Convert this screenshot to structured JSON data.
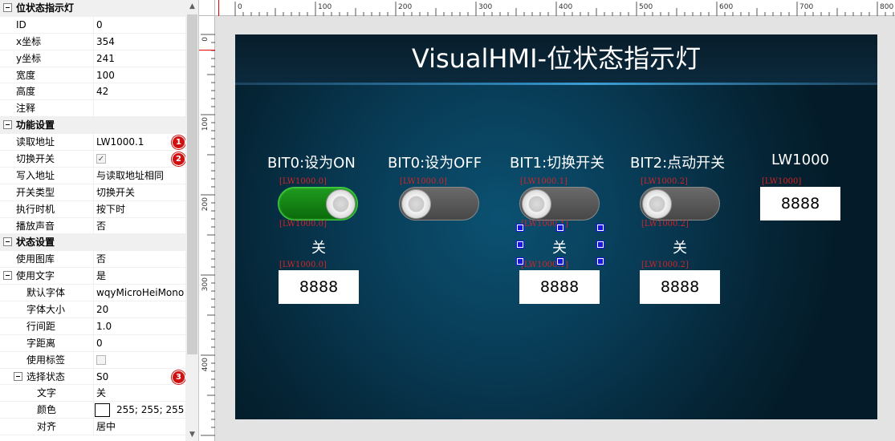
{
  "property_grid": {
    "rows": [
      {
        "kind": "category",
        "label": "位状态指示灯"
      },
      {
        "kind": "prop",
        "label": "ID",
        "value": "0"
      },
      {
        "kind": "prop",
        "label": "x坐标",
        "value": "354"
      },
      {
        "kind": "prop",
        "label": "y坐标",
        "value": "241"
      },
      {
        "kind": "prop",
        "label": "宽度",
        "value": "100"
      },
      {
        "kind": "prop",
        "label": "高度",
        "value": "42"
      },
      {
        "kind": "prop",
        "label": "注释",
        "value": ""
      },
      {
        "kind": "category",
        "label": "功能设置"
      },
      {
        "kind": "prop",
        "label": "读取地址",
        "value": "LW1000.1",
        "badge": "1"
      },
      {
        "kind": "check",
        "label": "切换开关",
        "checked": true,
        "badge": "2"
      },
      {
        "kind": "prop",
        "label": "写入地址",
        "value": "与读取地址相同"
      },
      {
        "kind": "prop",
        "label": "开关类型",
        "value": "切换开关"
      },
      {
        "kind": "prop",
        "label": "执行时机",
        "value": "按下时"
      },
      {
        "kind": "prop",
        "label": "播放声音",
        "value": "否"
      },
      {
        "kind": "category",
        "label": "状态设置"
      },
      {
        "kind": "prop",
        "label": "使用图库",
        "value": "否"
      },
      {
        "kind": "subcategory",
        "label": "使用文字",
        "value": "是"
      },
      {
        "kind": "prop",
        "indent": 2,
        "label": "默认字体",
        "value": "wqyMicroHeiMono"
      },
      {
        "kind": "prop",
        "indent": 2,
        "label": "字体大小",
        "value": "20"
      },
      {
        "kind": "prop",
        "indent": 2,
        "label": "行间距",
        "value": "1.0"
      },
      {
        "kind": "prop",
        "indent": 2,
        "label": "字距离",
        "value": "0"
      },
      {
        "kind": "check",
        "indent": 2,
        "label": "使用标签",
        "checked": false
      },
      {
        "kind": "subcategory",
        "indent": 2,
        "label": "选择状态",
        "value": "S0",
        "badge": "3"
      },
      {
        "kind": "prop",
        "indent": 3,
        "label": "文字",
        "value": "关"
      },
      {
        "kind": "color",
        "indent": 3,
        "label": "颜色",
        "value": "255; 255; 255",
        "color": "#ffffff"
      },
      {
        "kind": "prop",
        "indent": 3,
        "label": "对齐",
        "value": "居中"
      }
    ]
  },
  "ruler": {
    "h_labels": [
      "0",
      "100",
      "200",
      "300",
      "400",
      "500",
      "600",
      "700",
      "800"
    ],
    "v_labels": [
      "0",
      "100",
      "200",
      "300",
      "400"
    ]
  },
  "canvas": {
    "title": "VisualHMI-位状态指示灯",
    "columns": [
      {
        "label": "BIT0:设为ON",
        "addr_top": "[LW1000.0]",
        "switch_state": "on",
        "addr_bottom": "[LW1000.0]",
        "state_text": "关",
        "addr_num": "[LW1000.0]",
        "number": "8888"
      },
      {
        "label": "BIT0:设为OFF",
        "addr_top": "[LW1000.0]",
        "switch_state": "off"
      },
      {
        "label": "BIT1:切换开关",
        "addr_top": "[LW1000.1]",
        "switch_state": "off",
        "addr_bottom": "[LW1000.1]",
        "state_text": "关",
        "addr_num": "[LW1000.1]",
        "number": "8888"
      },
      {
        "label": "BIT2:点动开关",
        "addr_top": "[LW1000.2]",
        "switch_state": "off",
        "addr_bottom": "[LW1000.2]",
        "state_text": "关",
        "addr_num": "[LW1000.2]",
        "number": "8888"
      },
      {
        "label": "LW1000",
        "addr_top": "[LW1000]",
        "number": "8888"
      }
    ]
  },
  "colors": {
    "badge": "#d01010",
    "address_text": "#d42424",
    "selection_handle": "#1616e6",
    "switch_on": "#1f9b1f",
    "title_text": "#ffffff"
  }
}
